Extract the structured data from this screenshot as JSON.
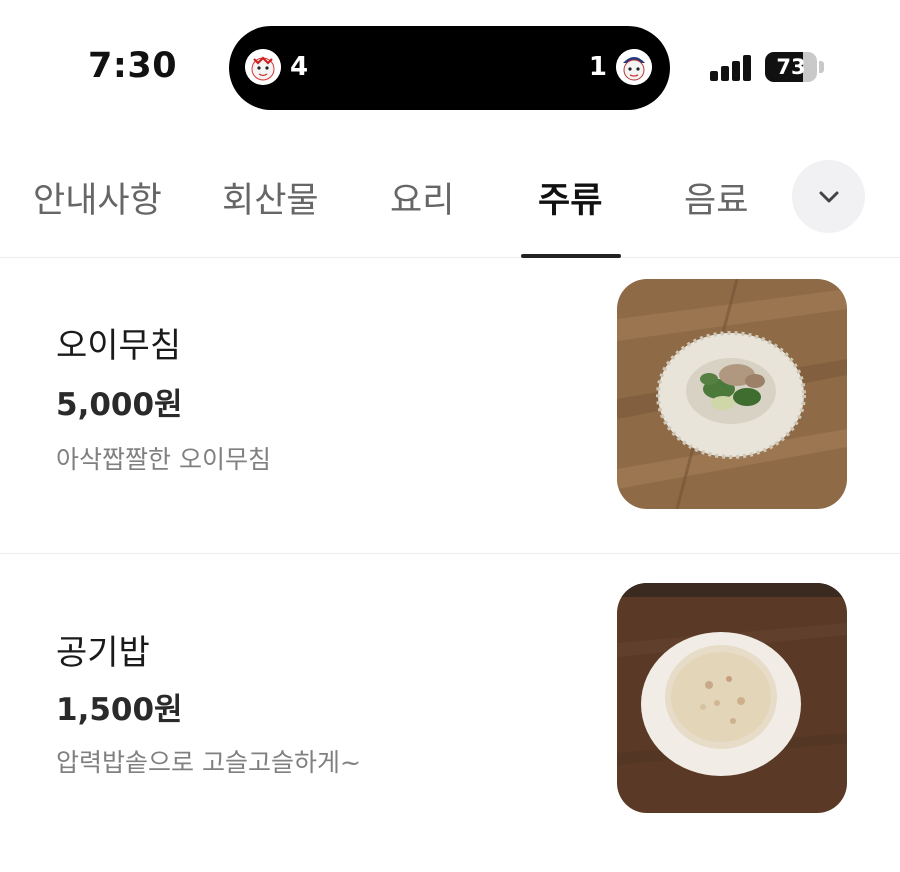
{
  "status_bar": {
    "time": "7:30",
    "live_activity": {
      "home_score": "4",
      "away_score": "1",
      "home_icon": "baseball-mascot-icon",
      "away_icon": "baseball-mascot-icon"
    },
    "battery_level": "73",
    "battery_fraction": 0.73,
    "signal_icon": "cellular-signal-icon"
  },
  "tabs": [
    {
      "label": "안내사항",
      "active": false
    },
    {
      "label": "회산물",
      "active": false
    },
    {
      "label": "요리",
      "active": false
    },
    {
      "label": "주류",
      "active": true
    },
    {
      "label": "음료",
      "active": false
    }
  ],
  "more_icon": "chevron-down-icon",
  "menu_items": [
    {
      "name": "오이무침",
      "price": "5,000원",
      "description": "아삭짭짤한 오이무침",
      "image_icon": "cucumber-salad-photo"
    },
    {
      "name": "공기밥",
      "price": "1,500원",
      "description": "압력밥솥으로 고슬고슬하게~",
      "image_icon": "rice-bowl-photo"
    }
  ],
  "colors": {
    "active_tab": "#111111",
    "inactive_tab": "#666666",
    "divider": "#ececec",
    "description": "#808080"
  }
}
